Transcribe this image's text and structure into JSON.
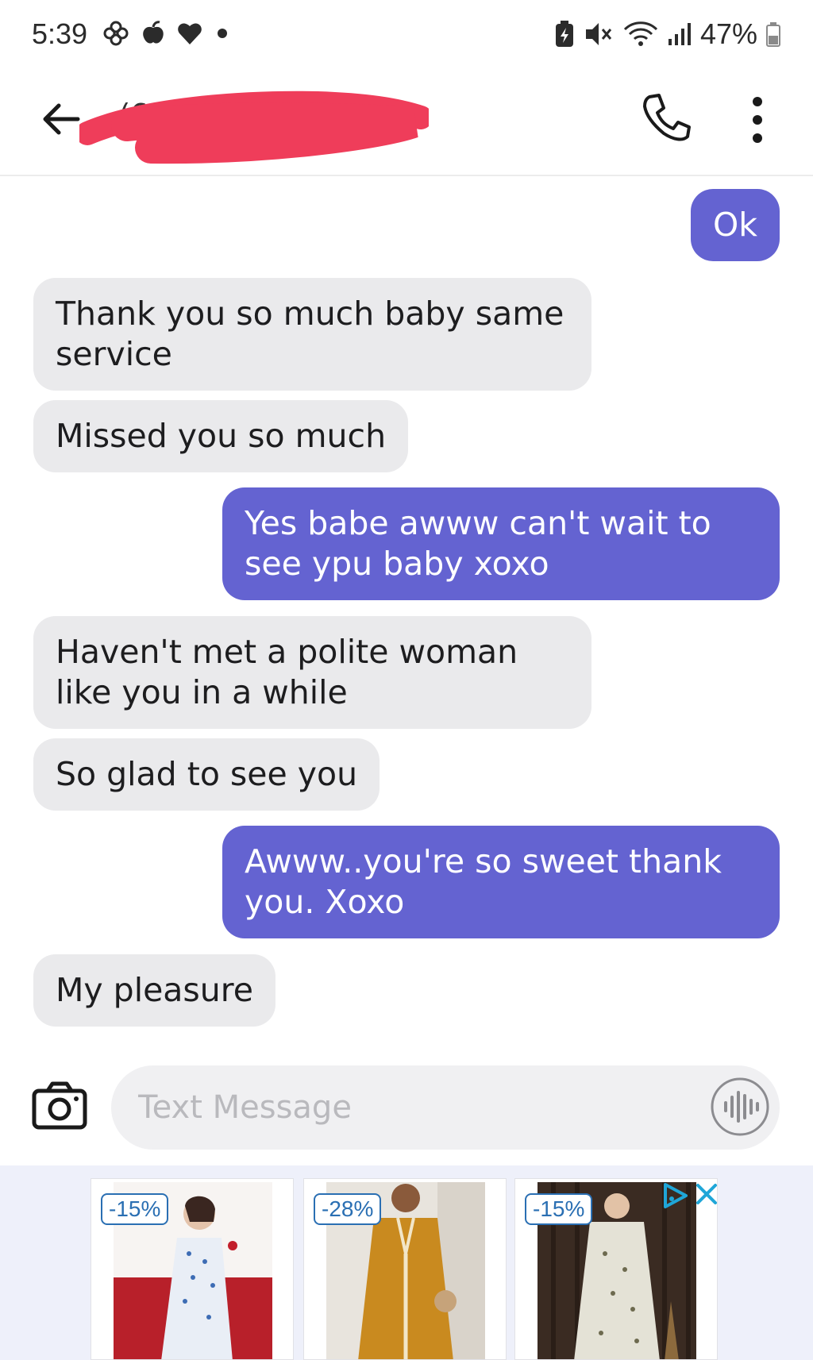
{
  "status_bar": {
    "time": "5:39",
    "battery": "47%"
  },
  "header": {
    "contact_name": "(64"
  },
  "messages": [
    {
      "dir": "out",
      "text": "Ok"
    },
    {
      "dir": "in",
      "text": "Thank you so much baby same service"
    },
    {
      "dir": "in",
      "text": "Missed you so much"
    },
    {
      "dir": "out",
      "text": "Yes babe awww can't wait to see ypu baby xoxo"
    },
    {
      "dir": "in",
      "text": "Haven't met a polite woman like you in a while"
    },
    {
      "dir": "in",
      "text": "So glad to see you"
    },
    {
      "dir": "out",
      "text": "Awww..you're so sweet thank you. Xoxo"
    },
    {
      "dir": "in",
      "text": "My pleasure"
    }
  ],
  "composer": {
    "placeholder": "Text Message",
    "value": ""
  },
  "ad": {
    "items": [
      {
        "discount": "-15%"
      },
      {
        "discount": "-28%"
      },
      {
        "discount": "-15%"
      }
    ]
  },
  "colors": {
    "outgoing_bubble": "#6463d1",
    "incoming_bubble": "#eaeaec",
    "redaction": "#ef3d5a"
  }
}
